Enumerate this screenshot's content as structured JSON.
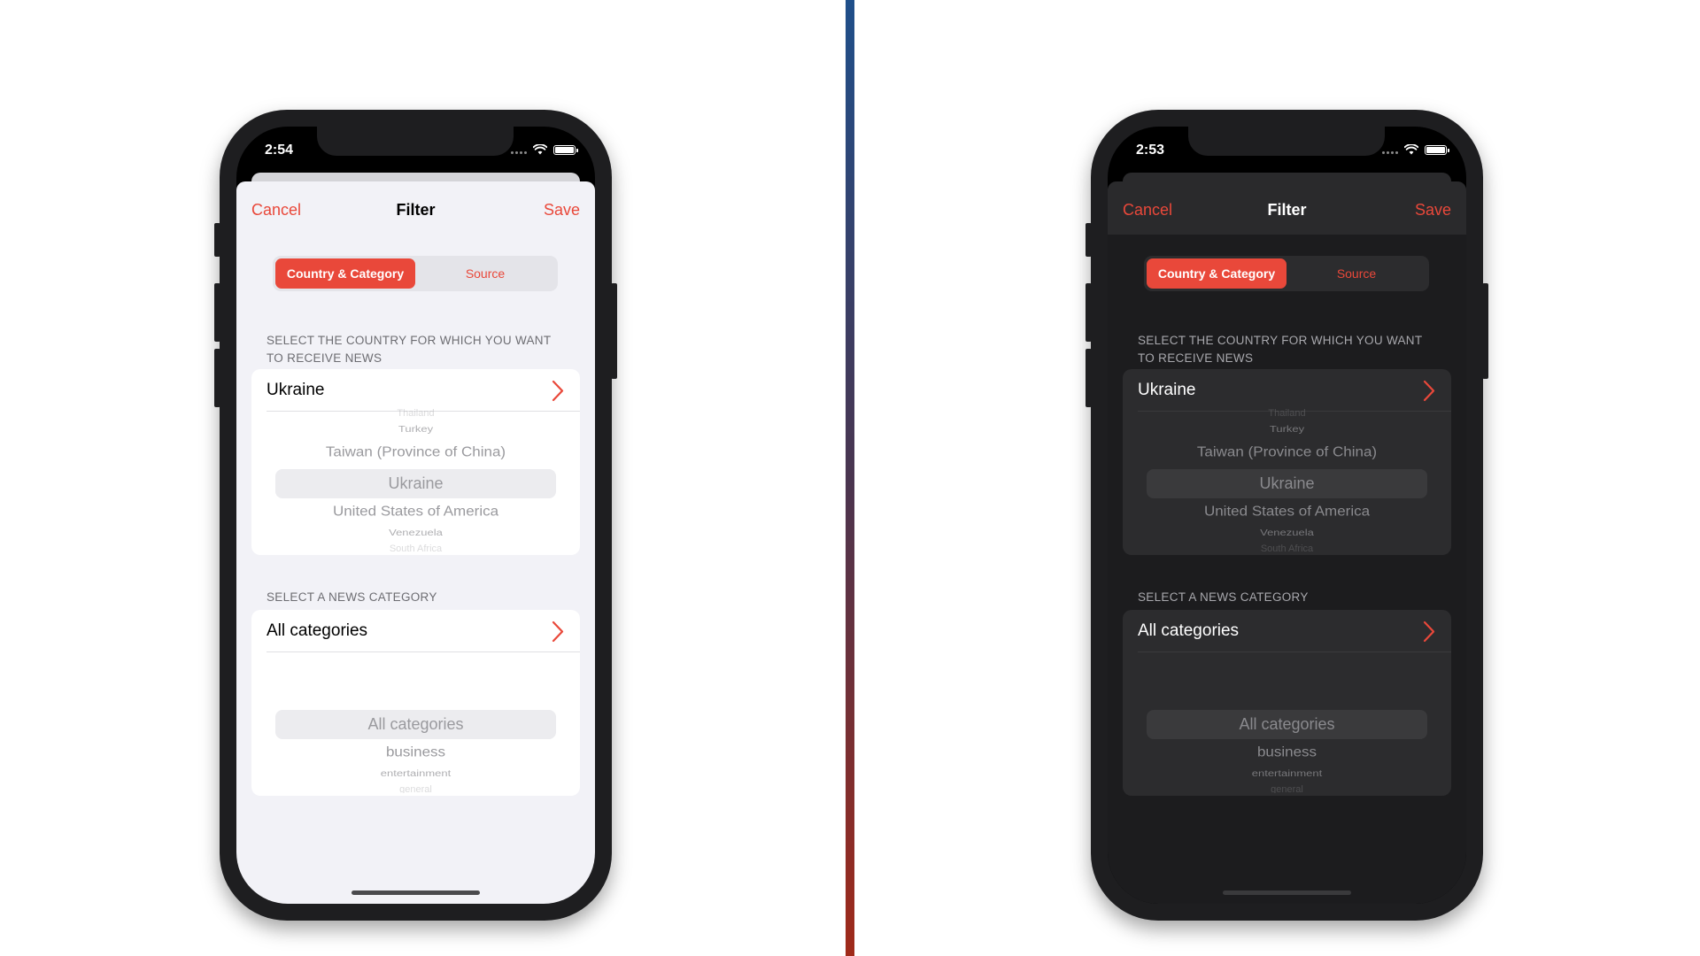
{
  "colors": {
    "accent": "#e9483a",
    "divider_top": "#1f4f8a",
    "divider_bottom": "#a02a1a"
  },
  "phones": [
    {
      "theme": "light",
      "time": "2:54",
      "nav": {
        "cancel": "Cancel",
        "title": "Filter",
        "save": "Save"
      },
      "tabs": [
        "Country & Category",
        "Source"
      ],
      "country_section": {
        "label": "SELECT THE COUNTRY FOR WHICH YOU WANT TO RECEIVE NEWS",
        "selected": "Ukraine",
        "picker": [
          "Thailand",
          "Turkey",
          "Taiwan (Province of China)",
          "Ukraine",
          "United States of America",
          "Venezuela",
          "South Africa"
        ]
      },
      "category_section": {
        "label": "SELECT A NEWS CATEGORY",
        "selected": "All categories",
        "picker": [
          "All categories",
          "business",
          "entertainment",
          "general"
        ]
      }
    },
    {
      "theme": "dark",
      "time": "2:53",
      "nav": {
        "cancel": "Cancel",
        "title": "Filter",
        "save": "Save"
      },
      "tabs": [
        "Country & Category",
        "Source"
      ],
      "country_section": {
        "label": "SELECT THE COUNTRY FOR WHICH YOU WANT TO RECEIVE NEWS",
        "selected": "Ukraine",
        "picker": [
          "Thailand",
          "Turkey",
          "Taiwan (Province of China)",
          "Ukraine",
          "United States of America",
          "Venezuela",
          "South Africa"
        ]
      },
      "category_section": {
        "label": "SELECT A NEWS CATEGORY",
        "selected": "All categories",
        "picker": [
          "All categories",
          "business",
          "entertainment",
          "general"
        ]
      }
    }
  ]
}
